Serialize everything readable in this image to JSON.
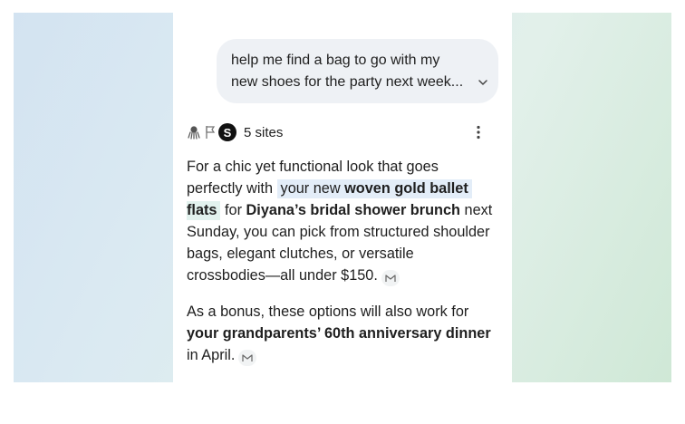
{
  "user_query": {
    "line1": "help me find a bag to go with my",
    "line2": "new shoes for the party next week..."
  },
  "sources": {
    "count_label": "5 sites",
    "icons": [
      "octopus-icon",
      "flag-icon",
      "s-logo-icon"
    ]
  },
  "answer": {
    "p1_l1": "For a chic yet functional look that goes",
    "p1_l2_pre": "perfectly with ",
    "p1_l2_hl": "your new ",
    "p1_l2_hl_bold": "woven gold ballet",
    "p1_l3_hl_bold": "flats",
    "p1_l3_mid": " for ",
    "p1_l3_bold": "Diyana’s bridal shower brunch",
    "p1_l3_post": " next",
    "p1_l4": "Sunday, you can pick from structured shoulder",
    "p1_l5": "bags, elegant clutches, or versatile",
    "p1_l6": "crossbodies—all under $150.",
    "p2_l1": "As a bonus, these options will also work for",
    "p2_l2_bold": "your grandparents’ 60th anniversary dinner",
    "p2_l3": "in April."
  },
  "colors": {
    "background_left": "#d3e3f1",
    "background_right": "#cfe8d6",
    "bubble": "#eef1f5",
    "highlight_blue": "#e3edf8",
    "highlight_green": "#e2f2ee"
  }
}
